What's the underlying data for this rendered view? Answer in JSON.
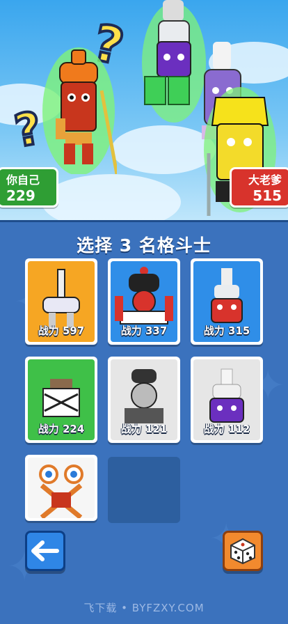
{
  "arena": {
    "player": {
      "name": "你自己",
      "score": "229"
    },
    "opponent": {
      "name": "大老爹",
      "score": "515"
    }
  },
  "panel": {
    "title": "选择 3 名格斗士",
    "cards": [
      {
        "label": "战力 597",
        "bg": "#f6a623"
      },
      {
        "label": "战力 337",
        "bg": "#2f8ee8"
      },
      {
        "label": "战力 315",
        "bg": "#2f8ee8"
      },
      {
        "label": "战力 224",
        "bg": "#3fc048"
      },
      {
        "label": "战力 121",
        "bg": "#e6e6e6"
      },
      {
        "label": "战力 112",
        "bg": "#e6e6e6"
      },
      {
        "label": "",
        "bg": "#f6f6f6"
      }
    ]
  },
  "buttons": {
    "back_icon": "left-arrow-icon",
    "dice_icon": "dice-icon"
  },
  "watermark": "飞下载 • BYFZXY.COM"
}
